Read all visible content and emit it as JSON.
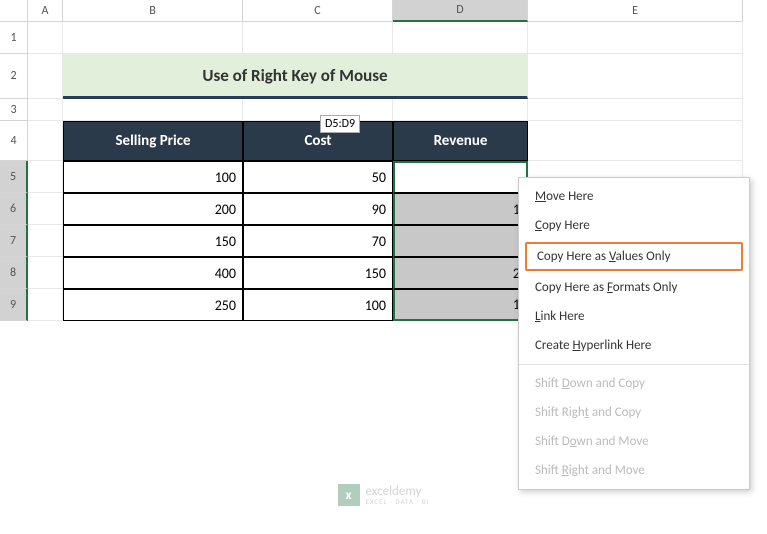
{
  "columns": [
    "A",
    "B",
    "C",
    "D",
    "E"
  ],
  "rows": [
    "1",
    "2",
    "3",
    "4",
    "5",
    "6",
    "7",
    "8",
    "9"
  ],
  "title": "Use of Right Key of Mouse",
  "name_box": "D5:D9",
  "table": {
    "headers": [
      "Selling Price",
      "Cost",
      "Revenue"
    ],
    "data": [
      {
        "selling": "100",
        "cost": "50",
        "revenue": ""
      },
      {
        "selling": "200",
        "cost": "90",
        "revenue": "1"
      },
      {
        "selling": "150",
        "cost": "70",
        "revenue": ""
      },
      {
        "selling": "400",
        "cost": "150",
        "revenue": "2"
      },
      {
        "selling": "250",
        "cost": "100",
        "revenue": "1"
      }
    ]
  },
  "context_menu": {
    "items": [
      {
        "label_pre": "",
        "key": "M",
        "label_post": "ove Here",
        "enabled": true
      },
      {
        "label_pre": "",
        "key": "C",
        "label_post": "opy Here",
        "enabled": true
      },
      {
        "label_pre": "Copy Here as ",
        "key": "V",
        "label_post": "alues Only",
        "enabled": true,
        "highlighted": true
      },
      {
        "label_pre": "Copy Here as ",
        "key": "F",
        "label_post": "ormats Only",
        "enabled": true
      },
      {
        "label_pre": "",
        "key": "L",
        "label_post": "ink Here",
        "enabled": true
      },
      {
        "label_pre": "Create ",
        "key": "H",
        "label_post": "yperlink Here",
        "enabled": true
      },
      {
        "separator": true
      },
      {
        "label_pre": "Shift ",
        "key": "D",
        "label_post": "own and Copy",
        "enabled": false
      },
      {
        "label_pre": "Shift Righ",
        "key": "t",
        "label_post": " and Copy",
        "enabled": false
      },
      {
        "label_pre": "Shift D",
        "key": "o",
        "label_post": "wn and Move",
        "enabled": false
      },
      {
        "label_pre": "Shift ",
        "key": "R",
        "label_post": "ight and Move",
        "enabled": false
      }
    ]
  },
  "watermark": {
    "name": "exceldemy",
    "sub": "EXCEL · DATA · BI"
  }
}
